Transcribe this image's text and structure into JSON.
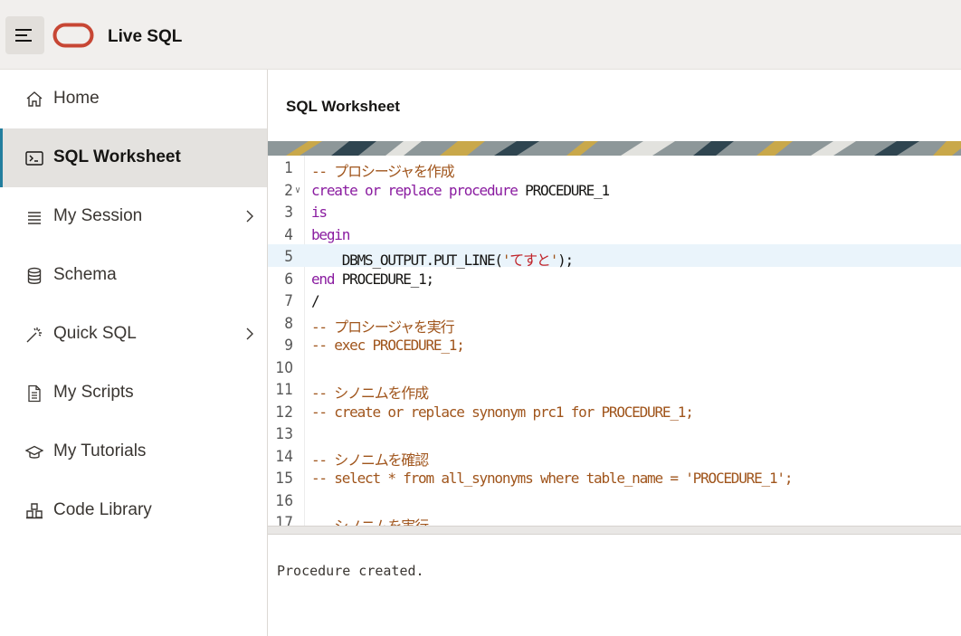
{
  "header": {
    "app_title": "Live SQL",
    "menu_icon": "hamburger-icon",
    "logo": "oracle-logo",
    "brand_color": "#c74634"
  },
  "sidebar": {
    "items": [
      {
        "label": "Home",
        "icon": "home-icon",
        "active": false,
        "has_chevron": false
      },
      {
        "label": "SQL Worksheet",
        "icon": "terminal-icon",
        "active": true,
        "has_chevron": false
      },
      {
        "label": "My Session",
        "icon": "list-icon",
        "active": false,
        "has_chevron": true
      },
      {
        "label": "Schema",
        "icon": "database-icon",
        "active": false,
        "has_chevron": false
      },
      {
        "label": "Quick SQL",
        "icon": "magic-wand-icon",
        "active": false,
        "has_chevron": true
      },
      {
        "label": "My Scripts",
        "icon": "document-icon",
        "active": false,
        "has_chevron": false
      },
      {
        "label": "My Tutorials",
        "icon": "graduation-cap-icon",
        "active": false,
        "has_chevron": false
      },
      {
        "label": "Code Library",
        "icon": "library-icon",
        "active": false,
        "has_chevron": false
      }
    ],
    "accent_color": "#227e9e"
  },
  "main": {
    "title": "SQL Worksheet",
    "editor": {
      "current_line": 5,
      "lines": [
        {
          "n": "1",
          "text": "-- プロシージャを作成"
        },
        {
          "n": "2",
          "text": "create or replace procedure PROCEDURE_1"
        },
        {
          "n": "3",
          "text": "is"
        },
        {
          "n": "4",
          "text": "begin"
        },
        {
          "n": "5",
          "text": "    DBMS_OUTPUT.PUT_LINE('てすと');"
        },
        {
          "n": "6",
          "text": "end PROCEDURE_1;"
        },
        {
          "n": "7",
          "text": "/"
        },
        {
          "n": "8",
          "text": "-- プロシージャを実行"
        },
        {
          "n": "9",
          "text": "-- exec PROCEDURE_1;"
        },
        {
          "n": "10",
          "text": ""
        },
        {
          "n": "11",
          "text": "-- シノニムを作成"
        },
        {
          "n": "12",
          "text": "-- create or replace synonym prc1 for PROCEDURE_1;"
        },
        {
          "n": "13",
          "text": ""
        },
        {
          "n": "14",
          "text": "-- シノニムを確認"
        },
        {
          "n": "15",
          "text": "-- select * from all_synonyms where table_name = 'PROCEDURE_1';"
        },
        {
          "n": "16",
          "text": ""
        },
        {
          "n": "17",
          "text": "-- シノニムを実行"
        }
      ]
    },
    "output": "Procedure created."
  }
}
